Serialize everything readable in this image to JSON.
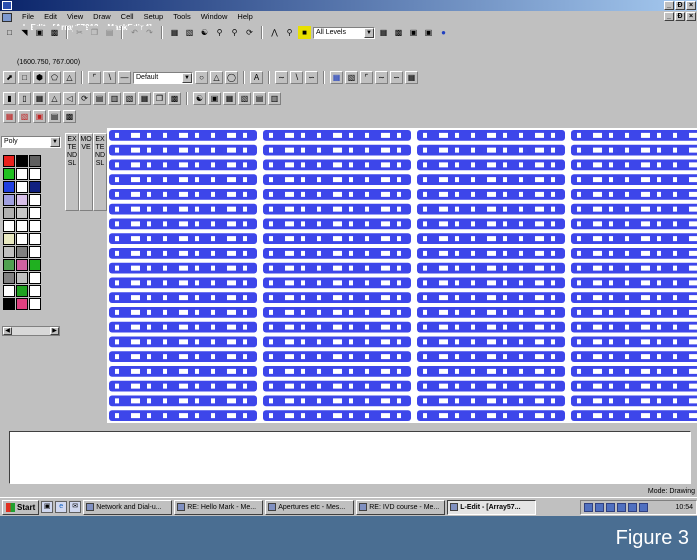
{
  "window": {
    "title": "L-Edit - [Array57913    MaskEdin4]",
    "minimize": "_",
    "restore": "Ɖ",
    "close": "×"
  },
  "menubar": {
    "items": [
      "File",
      "Edit",
      "View",
      "Draw",
      "Cell",
      "Setup",
      "Tools",
      "Window",
      "Help"
    ]
  },
  "toolbar1": {
    "layers_dropdown": "All Levels"
  },
  "toolbar2": {
    "style_dropdown": "Default"
  },
  "coordinates": "(1600.750, 767.000)",
  "sidebar": {
    "layer_dropdown": "Poly",
    "swatch_colors": [
      "#e8201c",
      "#000000",
      "#606060",
      "#20c020",
      "#ffffff",
      "#ffffff",
      "#2040e0",
      "#ffffff",
      "#102080",
      "#a0a0e0",
      "#d8c0e8",
      "#ffffff",
      "#b0b0b0",
      "#c8c8c8",
      "#ffffff",
      "#ffffff",
      "#ffffff",
      "#ffffff",
      "#e8e8c0",
      "#ffffff",
      "#ffffff",
      "#c0c0c0",
      "#808080",
      "#ffffff",
      "#50a050",
      "#d060a0",
      "#20b020",
      "#808080",
      "#c0c0c0",
      "#ffffff",
      "#ffffff",
      "#20a020",
      "#ffffff",
      "#000000",
      "#e04080",
      "#ffffff"
    ]
  },
  "palette_tabs": {
    "tab1": "EXTEND SL",
    "tab2": "MOVE",
    "tab3": "EXTEND SL"
  },
  "canvas": {
    "fill_color": "#3d46ea",
    "row_count": 20,
    "column_count": 4
  },
  "status": {
    "mode": "Mode: Drawing"
  },
  "taskbar": {
    "start": "Start",
    "tasks": [
      "Network and Dial-u...",
      "RE: Hello Mark - Me...",
      "Apertures etc - Mes...",
      "RE: IVD course - Me...",
      "L-Edit - [Array57..."
    ],
    "clock": "10:54"
  },
  "caption": "Figure 3"
}
